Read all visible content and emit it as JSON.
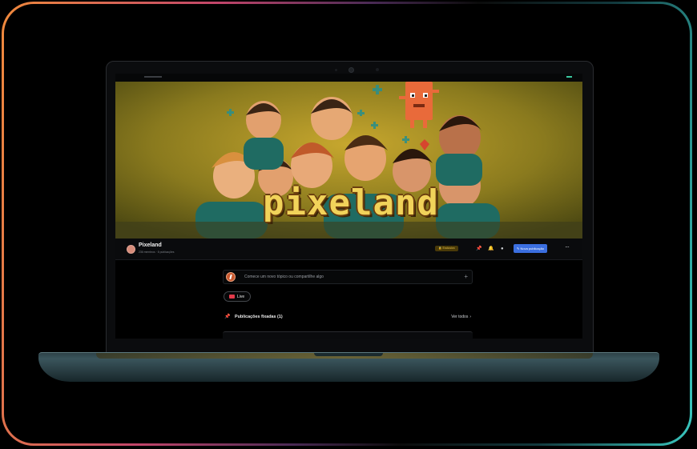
{
  "community": {
    "brand_word": "pixeland",
    "name": "Pixeland",
    "meta": "236 membros · 8 publicações",
    "exclusive_badge": "🔒 Exclusivo",
    "new_post_button": "✎ Nova publicação",
    "more": "···"
  },
  "feed": {
    "composer_placeholder": "Comece um novo tópico ou compartilhe algo",
    "composer_plus": "+",
    "live_label": "Live",
    "pinned_title": "Publicações fixadas (1)",
    "see_all": "Ver todos"
  },
  "icons": {
    "header": [
      "pin-icon",
      "bell-icon",
      "moon-icon"
    ],
    "pinned": "pin-icon",
    "more": "more-dots-icon",
    "live": "live-icon"
  },
  "colors": {
    "accent": "#3b6fe0",
    "exclusive_bg": "#4a3a08",
    "exclusive_text": "#e9c24a",
    "live": "#e23a4a",
    "frame_gradient": [
      "#f08a3c",
      "#c2456a",
      "#3ac8c0"
    ]
  }
}
